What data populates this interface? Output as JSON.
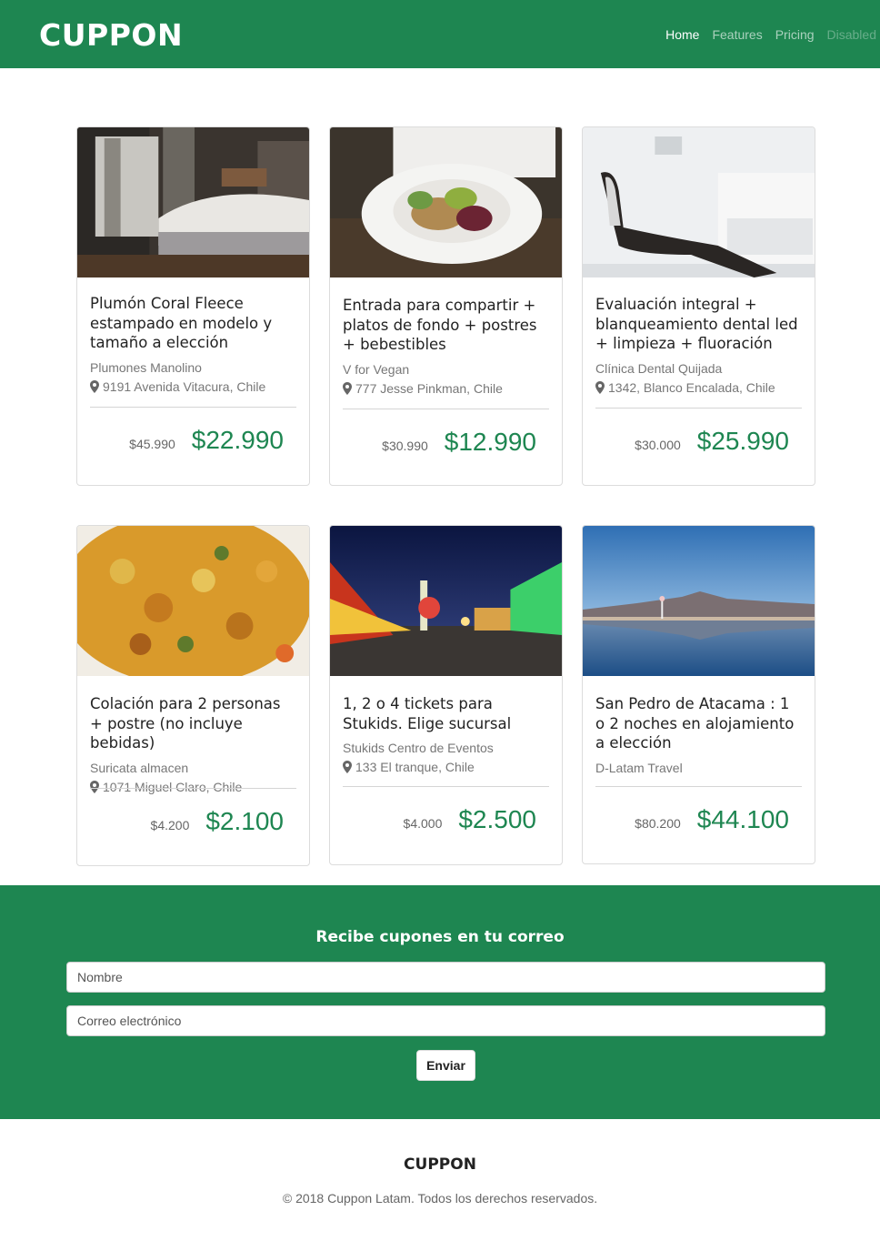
{
  "brand": "CUPPON",
  "nav": {
    "home": "Home",
    "features": "Features",
    "pricing": "Pricing",
    "disabled": "Disabled"
  },
  "cards": [
    {
      "image": "bedroom-photo",
      "title": "Plumón Coral Fleece estampado en modelo y tamaño a elección",
      "vendor": "Plumones Manolino",
      "address": "9191 Avenida Vitacura, Chile",
      "old_price": "$45.990",
      "new_price": "$22.990"
    },
    {
      "image": "salad-plate-photo",
      "title": "Entrada para compartir + platos de fondo + postres + bebestibles",
      "vendor": "V for Vegan",
      "address": "777 Jesse Pinkman, Chile",
      "old_price": "$30.990",
      "new_price": "$12.990"
    },
    {
      "image": "dental-chair-photo",
      "title": "Evaluación integral + blanqueamiento dental led + limpieza + fluoración",
      "vendor": "Clínica Dental Quijada",
      "address": "1342, Blanco Encalada, Chile",
      "old_price": "$30.000",
      "new_price": "$25.990"
    },
    {
      "image": "food-dish-photo",
      "title": "Colación para 2 personas + postre (no incluye bebidas)",
      "vendor": "Suricata almacen",
      "address": "1071 Miguel Claro, Chile",
      "old_price": "$4.200",
      "new_price": "$2.100"
    },
    {
      "image": "amusement-park-photo",
      "title": "1, 2 o 4 tickets para Stukids. Elige sucursal",
      "vendor": "Stukids Centro de Eventos",
      "address": "133 El tranque, Chile",
      "old_price": "$4.000",
      "new_price": "$2.500"
    },
    {
      "image": "lake-landscape-photo",
      "title": "San Pedro de Atacama : 1 o 2 noches en alojamiento a elección",
      "vendor": "D-Latam Travel",
      "address": "",
      "old_price": "$80.200",
      "new_price": "$44.100"
    }
  ],
  "subscribe": {
    "title": "Recibe cupones en tu correo",
    "name_placeholder": "Nombre",
    "email_placeholder": "Correo electrónico",
    "submit": "Enviar"
  },
  "footer": {
    "brand": "CUPPON",
    "copyright": "© 2018 Cuppon Latam. Todos los derechos reservados."
  },
  "colors": {
    "primary": "#1e8651"
  }
}
